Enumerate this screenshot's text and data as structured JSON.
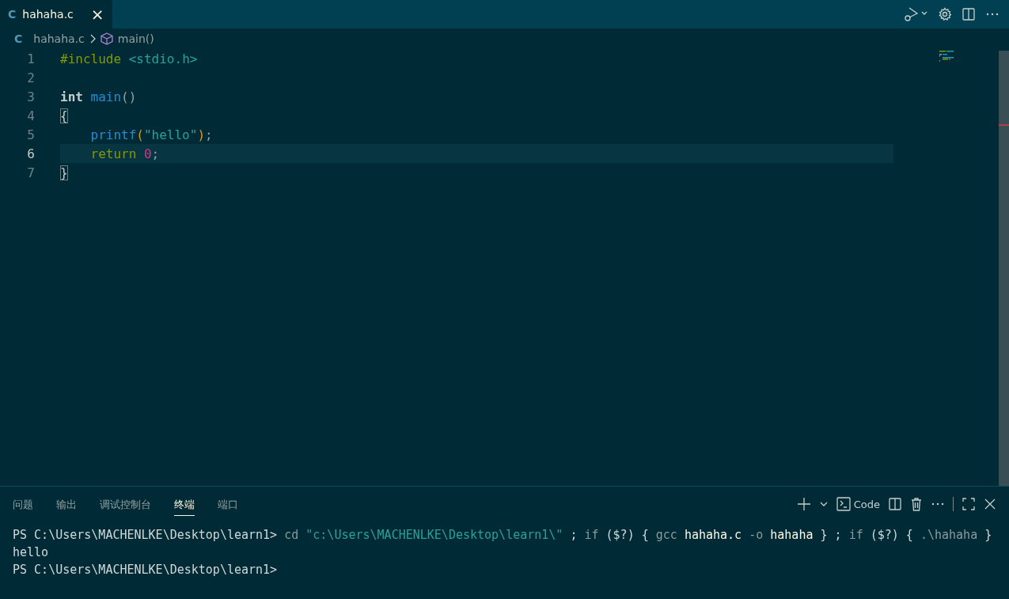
{
  "tabs": [
    {
      "icon_text": "C",
      "label": "hahaha.c",
      "close": "×",
      "selected": true
    }
  ],
  "editor_actions": [
    {
      "kind": "run-debug"
    },
    {
      "kind": "settings"
    },
    {
      "kind": "split"
    },
    {
      "kind": "more"
    }
  ],
  "breadcrumbs": [
    {
      "icon_text": "C",
      "label": "hahaha.c"
    },
    {
      "label": "main()"
    }
  ],
  "code_lines": [
    {
      "number": "1",
      "current": false,
      "tokens": [
        {
          "kind": "preproc",
          "text": "#include"
        },
        {
          "kind": "string",
          "text": " <stdio.h>"
        }
      ]
    },
    {
      "number": "2",
      "current": false
    },
    {
      "number": "3",
      "current": false,
      "tokens": [
        {
          "kind": "type",
          "text": "int"
        },
        {
          "kind": "function",
          "text": " main"
        },
        {
          "kind": "plain",
          "text": "()"
        }
      ]
    },
    {
      "number": "4",
      "current": false,
      "tokens": [
        {
          "kind": "bracket-match",
          "text": "{"
        }
      ]
    },
    {
      "number": "5",
      "current": false,
      "indented": true,
      "tokens": [
        {
          "kind": "function",
          "text": "printf"
        },
        {
          "kind": "paren",
          "text": "("
        },
        {
          "kind": "string",
          "text": "\"hello\""
        },
        {
          "kind": "paren",
          "text": ")"
        },
        {
          "kind": "plain",
          "text": ";"
        }
      ]
    },
    {
      "number": "6",
      "current": true,
      "indented": true,
      "tokens": [
        {
          "kind": "keyword",
          "text": "return"
        },
        {
          "kind": "number",
          "text": " 0"
        },
        {
          "kind": "plain",
          "text": ";"
        }
      ]
    },
    {
      "number": "7",
      "current": false,
      "tokens": [
        {
          "kind": "bracket-match",
          "text": "}"
        }
      ]
    }
  ],
  "panel_tabs": [
    {
      "label": "问题",
      "selected": false
    },
    {
      "label": "输出",
      "selected": false
    },
    {
      "label": "调试控制台",
      "selected": false
    },
    {
      "label": "终端",
      "selected": true
    },
    {
      "label": "端口",
      "selected": false
    }
  ],
  "panel_actions": [
    {
      "kind": "add"
    },
    {
      "kind": "dropdown"
    },
    {
      "kind": "terminal",
      "label": "Code"
    },
    {
      "kind": "split"
    },
    {
      "kind": "trash"
    },
    {
      "kind": "more"
    },
    {
      "kind": "separator"
    },
    {
      "kind": "maximize"
    },
    {
      "kind": "close"
    }
  ],
  "terminal_lines": [
    [
      {
        "kind": "prompt",
        "text": "PS C:\\Users\\MACHENLKE\\Desktop\\learn1> "
      },
      {
        "kind": "dim",
        "text": "cd "
      },
      {
        "kind": "string",
        "text": "\"c:\\Users\\MACHENLKE\\Desktop\\learn1\\\""
      },
      {
        "kind": "prompt",
        "text": " ; "
      },
      {
        "kind": "dim",
        "text": "if "
      },
      {
        "kind": "prompt",
        "text": "($?) { "
      },
      {
        "kind": "dim",
        "text": "gcc "
      },
      {
        "kind": "bright",
        "text": "hahaha.c"
      },
      {
        "kind": "dim",
        "text": " -o "
      },
      {
        "kind": "bright",
        "text": "hahaha"
      },
      {
        "kind": "prompt",
        "text": " } ; "
      },
      {
        "kind": "dim",
        "text": "if "
      },
      {
        "kind": "prompt",
        "text": "($?) { "
      },
      {
        "kind": "dim",
        "text": ".\\hahaha"
      },
      {
        "kind": "prompt",
        "text": " }"
      }
    ],
    [
      {
        "kind": "prompt",
        "text": "hello"
      }
    ],
    [
      {
        "kind": "prompt",
        "text": "PS C:\\Users\\MACHENLKE\\Desktop\\learn1>"
      }
    ]
  ]
}
